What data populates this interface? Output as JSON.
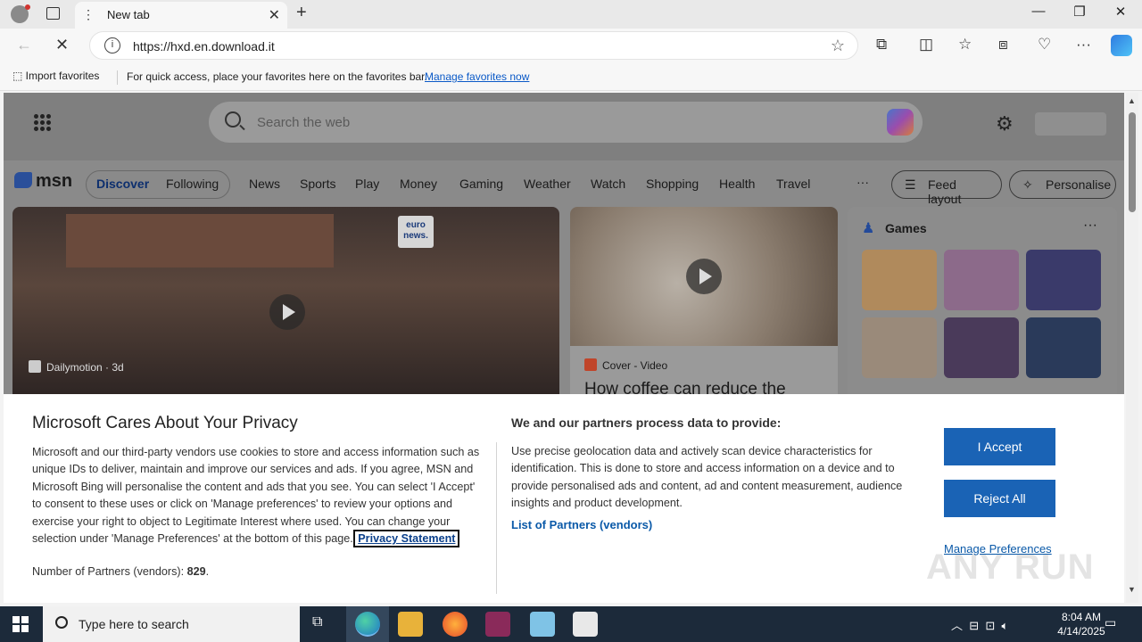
{
  "browser": {
    "tab_title": "New tab",
    "url": "https://hxd.en.download.it",
    "favorites": {
      "import_label": "Import favorites",
      "hint": "For quick access, place your favorites here on the favorites bar.",
      "manage_link": "Manage favorites now"
    }
  },
  "msn": {
    "search_placeholder": "Search the web",
    "logo": "msn",
    "tabs": [
      "Discover",
      "Following"
    ],
    "nav": [
      "News",
      "Sports",
      "Play",
      "Money",
      "Gaming",
      "Weather",
      "Watch",
      "Shopping",
      "Health",
      "Travel"
    ],
    "more": "···",
    "feed_layout": "Feed layout",
    "personalise": "Personalise",
    "hero": {
      "badge": "euro news.",
      "source": "Dailymotion · 3d"
    },
    "coffee": {
      "source": "Cover - Video",
      "headline": "How coffee can reduce the"
    },
    "games": {
      "title": "Games",
      "more": "···"
    }
  },
  "consent": {
    "title": "Microsoft Cares About Your Privacy",
    "body": "Microsoft and our third-party vendors use cookies to store and access information such as unique IDs to deliver, maintain and improve our services and ads. If you agree, MSN and Microsoft Bing will personalise the content and ads that you see. You can select 'I Accept' to consent to these uses or click on 'Manage preferences' to review your options and exercise your right to object to Legitimate Interest where used.  You can change your selection under 'Manage Preferences' at the bottom of this page.",
    "privacy_link": "Privacy Statement",
    "partners_label": "Number of Partners (vendors):",
    "partners_count": "829",
    "purposes_title": "We and our partners process data to provide:",
    "purposes_body": "Use precise geolocation data and actively scan device characteristics for identification. This is done to store and access information on a device and to provide personalised ads and content, ad and content measurement, audience insights and product development.",
    "partners_link": "List of Partners (vendors)",
    "accept": "I Accept",
    "reject": "Reject All",
    "manage": "Manage Preferences"
  },
  "watermark": "ANY RUN",
  "taskbar": {
    "search_placeholder": "Type here to search",
    "time": "8:04 AM",
    "date": "4/14/2025"
  },
  "colors": {
    "accent_blue": "#1a63b5",
    "link_blue": "#0a59a8",
    "taskbar": "#1c2a3a"
  }
}
